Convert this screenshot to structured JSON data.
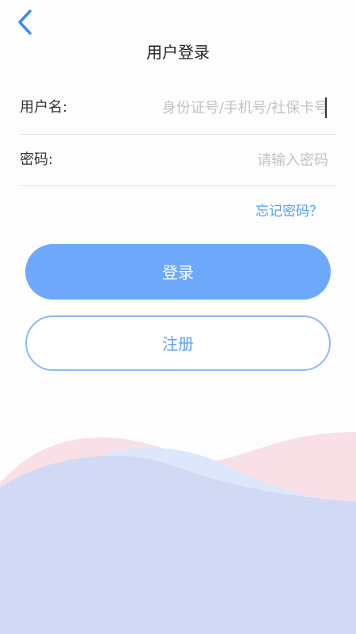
{
  "header": {
    "back_icon": "chevron-left-icon",
    "title": "用户登录"
  },
  "form": {
    "username": {
      "label": "用户名:",
      "placeholder": "身份证号/手机号/社保卡号",
      "value": ""
    },
    "password": {
      "label": "密码:",
      "placeholder": "请输入密码",
      "value": ""
    },
    "forgot_label": "忘记密码？"
  },
  "actions": {
    "login_label": "登录",
    "register_label": "注册"
  },
  "colors": {
    "accent": "#4f9ef8",
    "login_button": "#6ea8fb",
    "register_border": "#8fb9f3",
    "wave_pink": "#f9dfe6",
    "wave_blue": "#dbe5fb",
    "wave_lavender": "#cfd6f3"
  }
}
